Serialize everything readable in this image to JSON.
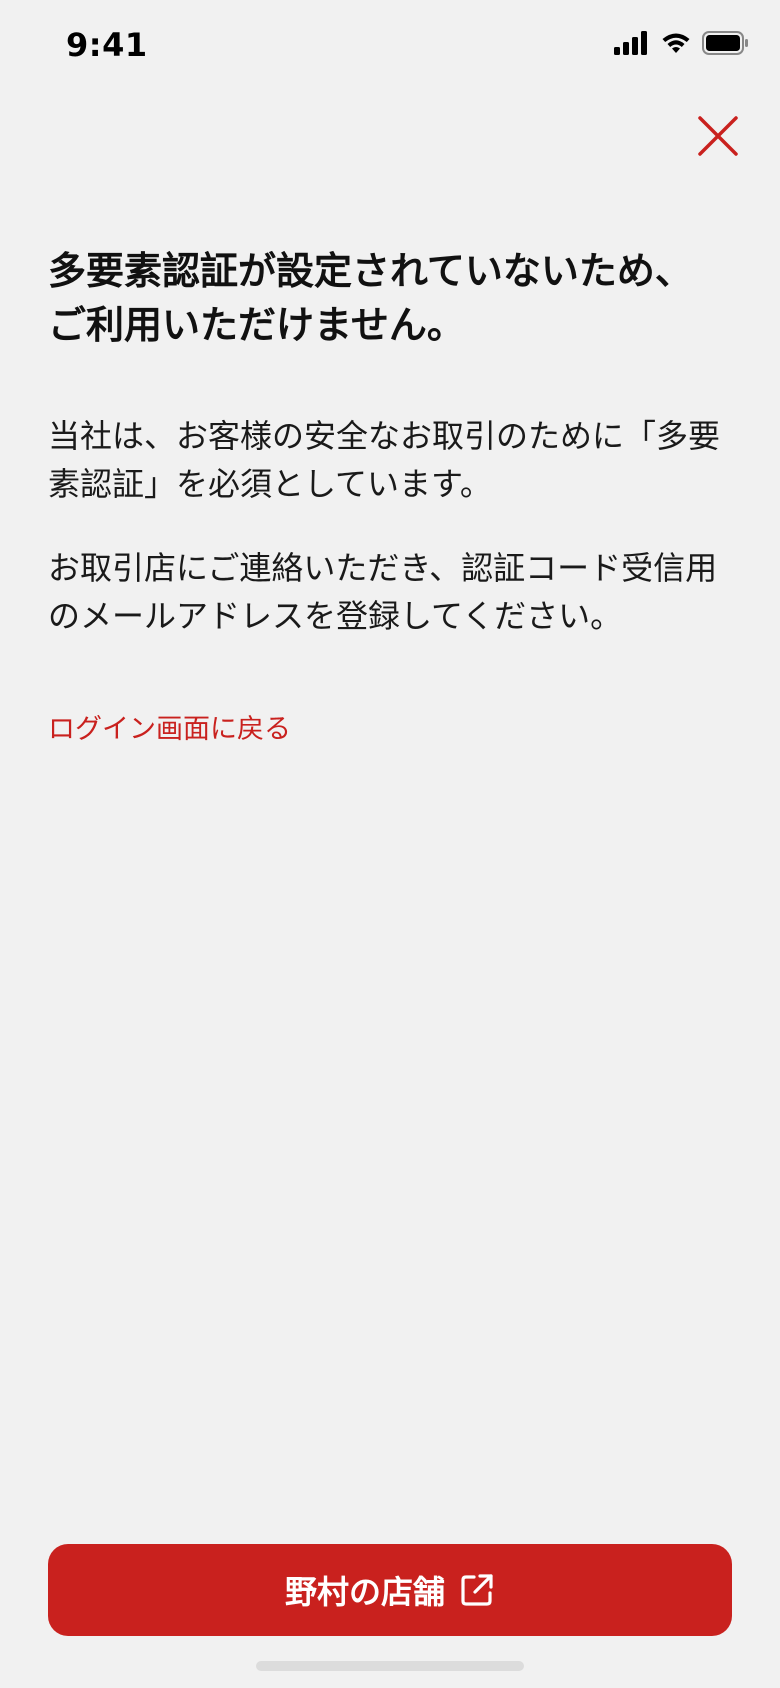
{
  "status_bar": {
    "time": "9:41",
    "signal_icon": "signal-bars-icon",
    "wifi_icon": "wifi-icon",
    "battery_icon": "battery-icon"
  },
  "header": {
    "close_icon": "close-icon"
  },
  "main": {
    "title": "多要素認証が設定されていないため、ご利用いただけません。",
    "paragraph_1": "当社は、お客様の安全なお取引のために「多要素認証」を必須としています。",
    "paragraph_2": "お取引店にご連絡いただき、認証コード受信用のメールアドレスを登録してください。",
    "back_link": "ログイン画面に戻る"
  },
  "footer": {
    "cta_label": "野村の店舗",
    "cta_icon": "external-link-icon"
  },
  "colors": {
    "accent": "#c9211e",
    "background": "#f1f1f1",
    "text": "#111111"
  }
}
